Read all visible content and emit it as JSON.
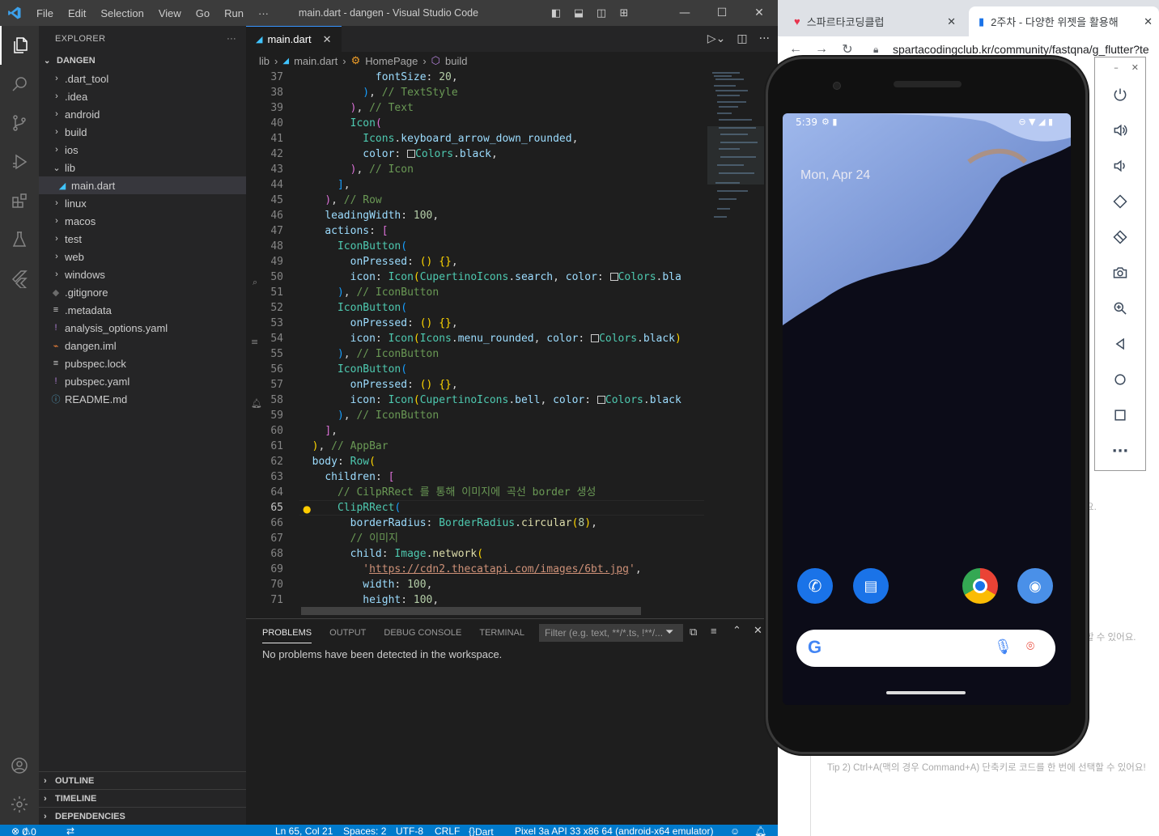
{
  "vscode": {
    "menu": [
      "File",
      "Edit",
      "Selection",
      "View",
      "Go",
      "Run",
      "···"
    ],
    "window_title": "main.dart - dangen - Visual Studio Code",
    "explorer_label": "EXPLORER",
    "project": "DANGEN",
    "tree": [
      {
        "name": ".dart_tool",
        "type": "folder"
      },
      {
        "name": ".idea",
        "type": "folder"
      },
      {
        "name": "android",
        "type": "folder"
      },
      {
        "name": "build",
        "type": "folder"
      },
      {
        "name": "ios",
        "type": "folder"
      },
      {
        "name": "lib",
        "type": "folder-open"
      },
      {
        "name": "main.dart",
        "type": "dart"
      },
      {
        "name": "linux",
        "type": "folder"
      },
      {
        "name": "macos",
        "type": "folder"
      },
      {
        "name": "test",
        "type": "folder"
      },
      {
        "name": "web",
        "type": "folder"
      },
      {
        "name": "windows",
        "type": "folder"
      },
      {
        "name": ".gitignore",
        "type": "git"
      },
      {
        "name": ".metadata",
        "type": "lines"
      },
      {
        "name": "analysis_options.yaml",
        "type": "yaml"
      },
      {
        "name": "dangen.iml",
        "type": "rss"
      },
      {
        "name": "pubspec.lock",
        "type": "lines"
      },
      {
        "name": "pubspec.yaml",
        "type": "yaml"
      },
      {
        "name": "README.md",
        "type": "info"
      }
    ],
    "sections": [
      "OUTLINE",
      "TIMELINE",
      "DEPENDENCIES"
    ],
    "tab_label": "main.dart",
    "breadcrumbs": [
      "lib",
      "main.dart",
      "HomePage",
      "build"
    ],
    "first_line": 37,
    "current_line": 65,
    "panel_tabs": [
      "PROBLEMS",
      "OUTPUT",
      "DEBUG CONSOLE",
      "TERMINAL"
    ],
    "filter_placeholder": "Filter (e.g. text, **/*.ts, !**/...",
    "problems_message": "No problems have been detected in the workspace.",
    "status": {
      "errors": "0",
      "warnings": "0",
      "position": "Ln 65, Col 21",
      "spaces": "Spaces: 2",
      "encoding": "UTF-8",
      "eol": "CRLF",
      "language": "Dart",
      "device": "Pixel 3a API 33 x86 64 (android-x64 emulator)"
    }
  },
  "browser": {
    "tab1": "스파르타코딩클럽",
    "tab2": "2주차 - 다양한 위젯을 활용해",
    "url": "spartacodingclub.kr/community/fastqna/g_flutter?te",
    "side_text_1": "요.",
    "side_text_2": "할 수 있어요.",
    "bottom_text": "Tip 2) Ctrl+A(맥의 경우 Command+A) 단축키로 코드를 한 번에 선택할 수 있어요!"
  },
  "phone": {
    "time": "5:39",
    "date": "Mon, Apr 24"
  },
  "colors": {
    "accent": "#007acc",
    "editor_bg": "#1e1e1e",
    "sidebar_bg": "#252526"
  }
}
